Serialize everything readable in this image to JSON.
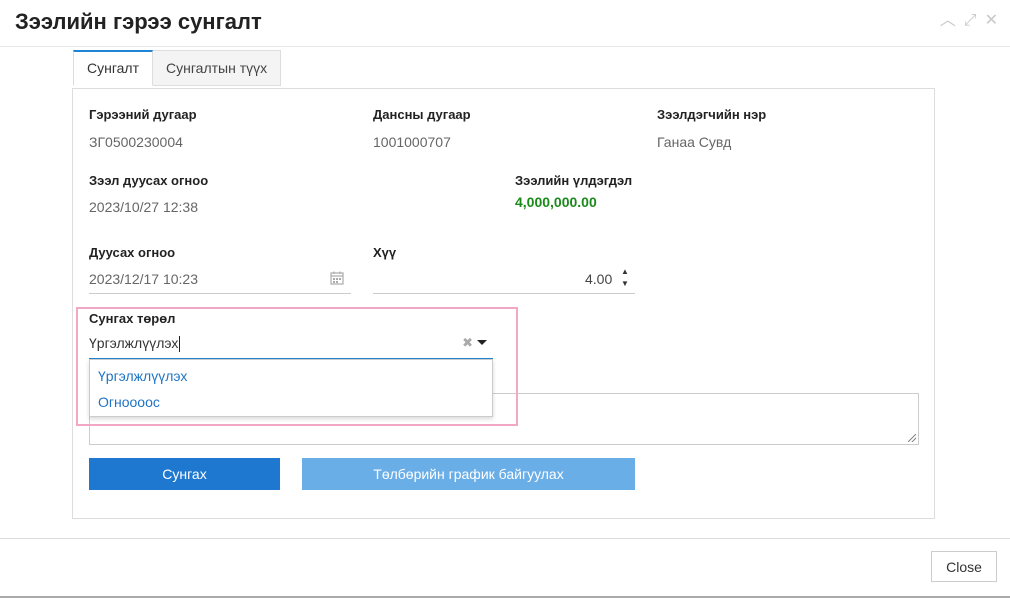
{
  "dialog": {
    "title": "Зээлийн гэрээ сунгалт",
    "controls": {
      "minimize": "^",
      "maximize": "⤢",
      "close": "✕"
    }
  },
  "tabs": [
    {
      "label": "Сунгалт",
      "active": true
    },
    {
      "label": "Сунгалтын түүх",
      "active": false
    }
  ],
  "fields": {
    "contract_no": {
      "label": "Гэрээний дугаар",
      "value": "ЗГ0500230004"
    },
    "account_no": {
      "label": "Дансны дугаар",
      "value": "1001000707"
    },
    "borrower": {
      "label": "Зээлдэгчийн нэр",
      "value": "Ганаа Сувд"
    },
    "loan_end": {
      "label": "Зээл дуусах огноо",
      "value": "2023/10/27 12:38"
    },
    "balance": {
      "label": "Зээлийн үлдэгдэл",
      "value": "4,000,000.00"
    },
    "end_date": {
      "label": "Дуусах огноо",
      "value": "2023/12/17 10:23"
    },
    "rate": {
      "label": "Хүү",
      "value": "4.00"
    },
    "extension_type": {
      "label": "Сунгах төрөл",
      "value": "Үргэлжлүүлэх",
      "options": [
        "Үргэлжлүүлэх",
        "Огноооос"
      ]
    }
  },
  "buttons": {
    "extend": "Сунгах",
    "schedule": "Төлбөрийн график байгуулах",
    "close": "Close"
  },
  "colors": {
    "primary": "#1e78d0",
    "primary_light": "#6aaee8",
    "balance_green": "#1a8a1a",
    "highlight": "#f2a8c4"
  }
}
